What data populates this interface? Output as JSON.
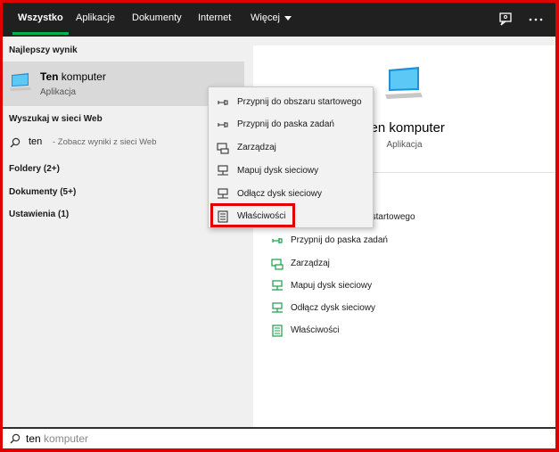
{
  "nav": {
    "tabs": [
      {
        "label": "Wszystko",
        "active": true
      },
      {
        "label": "Aplikacje"
      },
      {
        "label": "Dokumenty"
      },
      {
        "label": "Internet"
      },
      {
        "label": "Więcej"
      }
    ],
    "icons": [
      "feedback-icon",
      "more-options-icon"
    ]
  },
  "left": {
    "best_label": "Najlepszy wynik",
    "best": {
      "name_bold": "Ten",
      "name_rest": " komputer",
      "type": "Aplikacja"
    },
    "web_label": "Wyszukaj w sieci Web",
    "web": {
      "query": "ten",
      "hint": "- Zobacz wyniki z sieci Web"
    },
    "categories": [
      "Foldery (2+)",
      "Dokumenty (5+)",
      "Ustawienia (1)"
    ]
  },
  "right": {
    "title": "Ten komputer",
    "subtitle": "Aplikacja",
    "actions": [
      {
        "label": "Przypnij do obszaru startowego",
        "icon": "pin-icon"
      },
      {
        "label": "Przypnij do paska zadań",
        "icon": "pin-icon"
      },
      {
        "label": "Zarządzaj",
        "icon": "computer-manage-icon"
      },
      {
        "label": "Mapuj dysk sieciowy",
        "icon": "network-drive-icon"
      },
      {
        "label": "Odłącz dysk sieciowy",
        "icon": "network-drive-icon"
      },
      {
        "label": "Właściwości",
        "icon": "properties-icon"
      }
    ]
  },
  "context_menu": {
    "items": [
      {
        "label": "Przypnij do obszaru startowego",
        "icon": "pin-icon"
      },
      {
        "label": "Przypnij do paska zadań",
        "icon": "pin-icon"
      },
      {
        "label": "Zarządzaj",
        "icon": "computer-manage-icon"
      },
      {
        "label": "Mapuj dysk sieciowy",
        "icon": "network-drive-icon"
      },
      {
        "label": "Odłącz dysk sieciowy",
        "icon": "network-drive-icon"
      },
      {
        "label": "Właściwości",
        "icon": "properties-icon"
      }
    ]
  },
  "search": {
    "typed": "ten",
    "suggestion": " komputer"
  },
  "colors": {
    "accent_green": "#00b050",
    "highlight_red": "#e00000",
    "topbar": "#202020"
  }
}
